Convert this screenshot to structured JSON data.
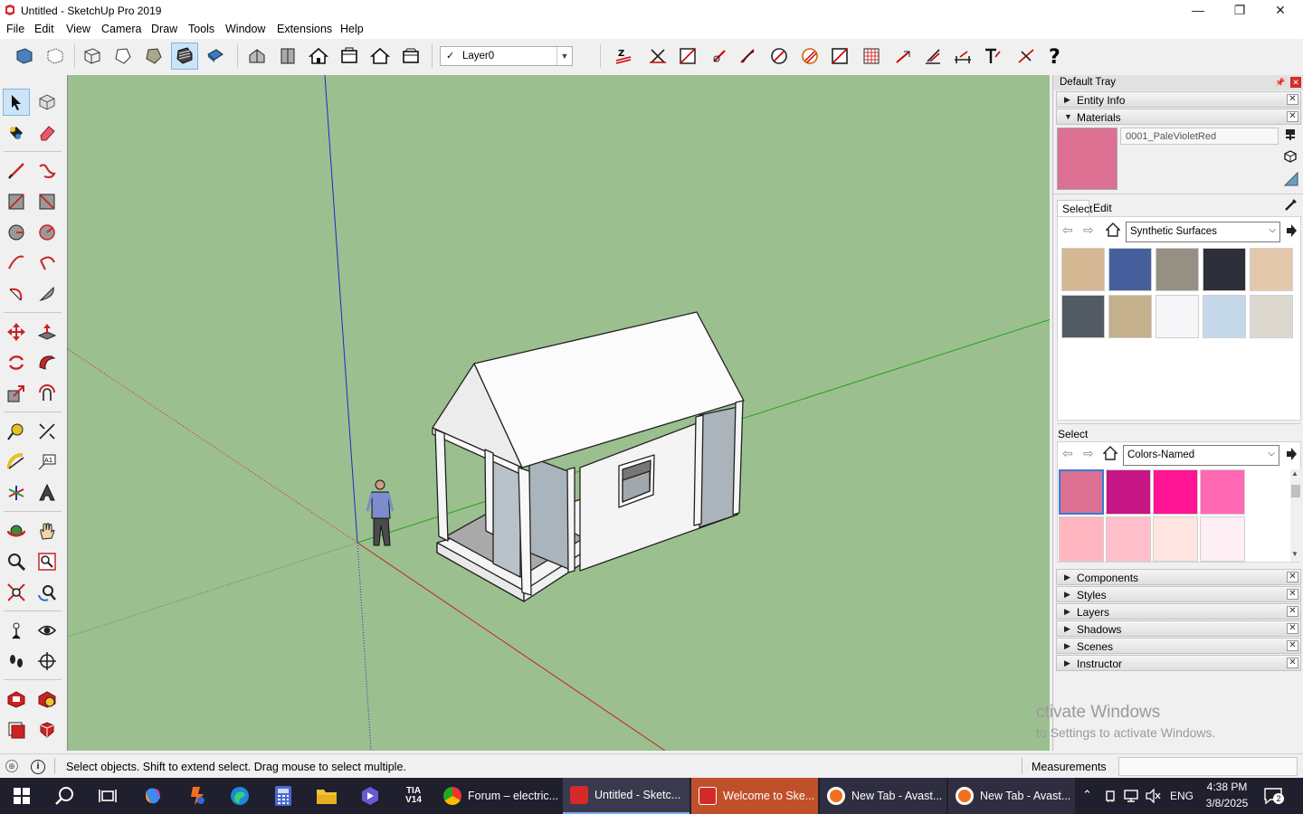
{
  "window": {
    "title": "Untitled - SketchUp Pro 2019",
    "minimize": "—",
    "maximize": "❐",
    "close": "✕"
  },
  "menu": [
    "File",
    "Edit",
    "View",
    "Camera",
    "Draw",
    "Tools",
    "Window",
    "Extensions",
    "Help"
  ],
  "layer": {
    "checkmark": "✓",
    "name": "Layer0"
  },
  "tray": {
    "title": "Default Tray",
    "entity_info": "Entity Info",
    "materials": {
      "title": "Materials",
      "current_name": "0001_PaleVioletRed",
      "current_color": "#dc7092",
      "tabs": [
        "Select",
        "Edit"
      ],
      "library": "Synthetic Surfaces",
      "library_swatches": [
        "#d4b894",
        "#46609e",
        "#959083",
        "#2d3038",
        "#e4c8ac",
        "#525a62",
        "#c4b08a",
        "#f6f6f8",
        "#c4d8ea",
        "#dcd8d0"
      ],
      "second_label": "Select",
      "second_library": "Colors-Named",
      "color_swatches": [
        "#db7093",
        "#c71585",
        "#ff1493",
        "#ff69b4",
        "#ffb6c1",
        "#ffc0cb",
        "#ffe4e1",
        "#fff0f5"
      ]
    },
    "panels": [
      "Components",
      "Styles",
      "Layers",
      "Shadows",
      "Scenes",
      "Instructor"
    ]
  },
  "status": {
    "message": "Select objects. Shift to extend select. Drag mouse to select multiple.",
    "measurements_label": "Measurements"
  },
  "watermark": {
    "line1": "ctivate Windows",
    "line2": "to Settings to activate Windows."
  },
  "taskbar": {
    "apps": [
      "Forum – electric...",
      "Untitled - Sketc...",
      "Welcome to Ske...",
      "New Tab - Avast...",
      "New Tab - Avast..."
    ],
    "tia_label": "TIA\nV14",
    "lang": "ENG",
    "time": "4:38 PM",
    "date": "3/8/2025",
    "notifications": "2"
  }
}
